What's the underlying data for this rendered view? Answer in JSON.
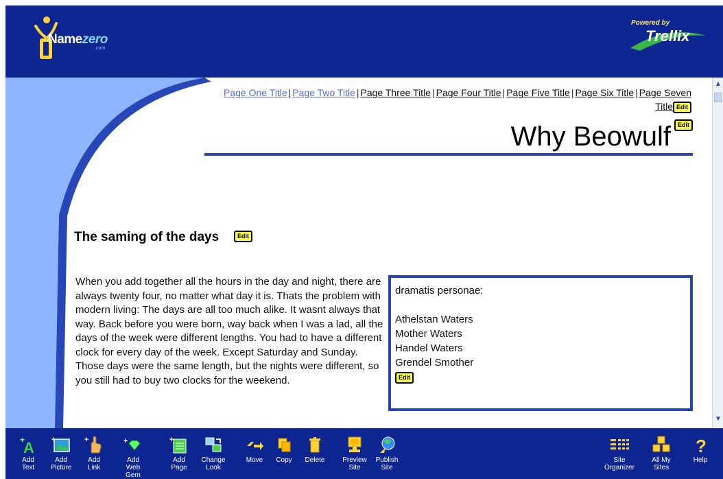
{
  "header": {
    "logo_text_main": "Name",
    "logo_text_accent": "zero",
    "logo_sub": ".com",
    "powered_by": "Powered by",
    "trellix": "Trellix"
  },
  "nav": {
    "links": [
      {
        "label": "Page One Title",
        "visited": true
      },
      {
        "label": "Page Two Title",
        "visited": true
      },
      {
        "label": "Page Three Title",
        "visited": false
      },
      {
        "label": "Page Four Title",
        "visited": false
      },
      {
        "label": "Page Five Title",
        "visited": false
      },
      {
        "label": "Page Six Title",
        "visited": false
      },
      {
        "label": "Page Seven Title",
        "visited": false
      }
    ],
    "separator": "|"
  },
  "edit_label": "Edit",
  "page": {
    "title": "Why Beowulf",
    "section_heading": "The saming of the days",
    "body_text": "When you add together all the hours in the day and night, there are always twenty four, no matter what day it is. Thats the problem with modern living: The days are all too much alike. It wasnt always that way. Back before you were born, way back when I was a lad, all the days of the week were different lengths. You had to have a different clock for every day of the week. Except Saturday and Sunday. Those days were the same length, but the nights were different, so you still had to buy two clocks for the weekend.",
    "sidebar": {
      "heading": "dramatis personae:",
      "names": [
        "Athelstan Waters",
        "Mother Waters",
        "Handel Waters",
        "Grendel Smother"
      ]
    }
  },
  "toolbar": {
    "tools": [
      {
        "label1": "Add",
        "label2": "Text",
        "icon": "add-text-icon"
      },
      {
        "label1": "Add",
        "label2": "Picture",
        "icon": "add-picture-icon"
      },
      {
        "label1": "Add",
        "label2": "Link",
        "icon": "add-link-icon"
      },
      {
        "label1": "Add",
        "label2": "Web Gem",
        "icon": "add-web-gem-icon"
      },
      {
        "label1": "Add",
        "label2": "Page",
        "icon": "add-page-icon"
      },
      {
        "label1": "Change",
        "label2": "Look",
        "icon": "change-look-icon"
      },
      {
        "label1": "Move",
        "label2": "",
        "icon": "move-icon"
      },
      {
        "label1": "Copy",
        "label2": "",
        "icon": "copy-icon"
      },
      {
        "label1": "Delete",
        "label2": "",
        "icon": "delete-icon"
      },
      {
        "label1": "Preview",
        "label2": "Site",
        "icon": "preview-site-icon"
      },
      {
        "label1": "Publish",
        "label2": "Site",
        "icon": "publish-site-icon"
      },
      {
        "label1": "Site",
        "label2": "Organizer",
        "icon": "site-organizer-icon"
      },
      {
        "label1": "All My",
        "label2": "Sites",
        "icon": "all-my-sites-icon"
      },
      {
        "label1": "Help",
        "label2": "",
        "icon": "help-icon"
      }
    ]
  },
  "colors": {
    "header_bg": "#0d2590",
    "panel_blue": "#8cb4ff",
    "rule_blue": "#2747b8",
    "edit_yellow": "#ffff44"
  }
}
